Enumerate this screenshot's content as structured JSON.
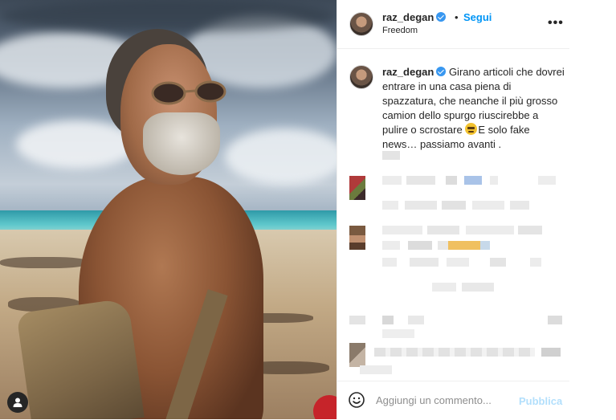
{
  "header": {
    "username": "raz_degan",
    "separator": "•",
    "follow_label": "Segui",
    "location": "Freedom",
    "more_label": "•••"
  },
  "caption": {
    "username": "raz_degan",
    "text_part1": "Girano articoli che dovrei entrare in una casa piena di spazzatura, che neanche il più grosso camion dello spurgo riuscirebbe a pulire o scrostare",
    "text_part2": "E solo fake news… passiamo avanti ."
  },
  "comment_box": {
    "placeholder": "Aggiungi un commento...",
    "publish_label": "Pubblica"
  },
  "colors": {
    "accent": "#0095f6",
    "verified": "#3897f0",
    "publish_disabled": "#b2dffc"
  },
  "icons": [
    "verified-badge-icon",
    "more-options-icon",
    "emoji-icon",
    "user-tag-icon"
  ]
}
